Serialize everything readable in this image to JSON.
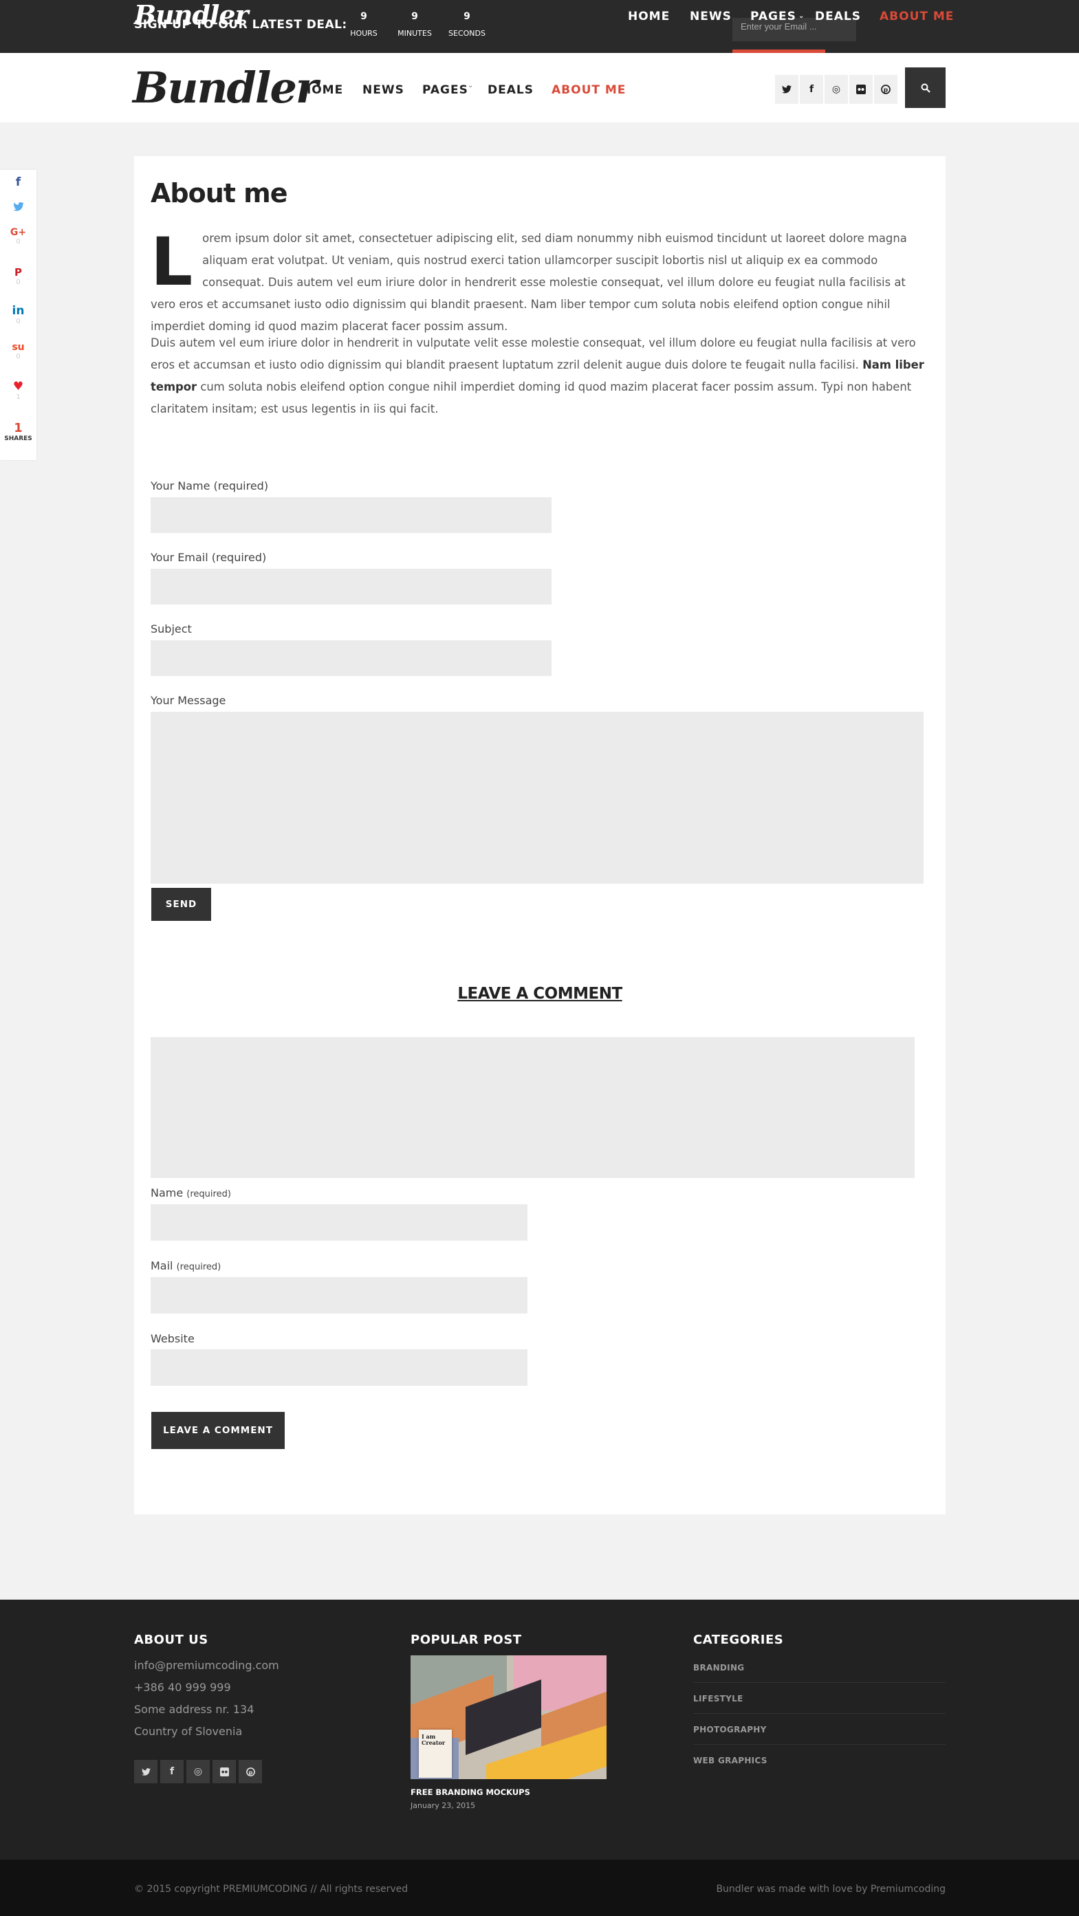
{
  "topbar": {
    "logo": "Bundler",
    "deal_text": "SIGN UP TO OUR LATEST DEAL:",
    "countdown": [
      {
        "value": "9",
        "unit": "HOURS"
      },
      {
        "value": "9",
        "unit": "MINUTES"
      },
      {
        "value": "9",
        "unit": "SECONDS"
      }
    ],
    "email_placeholder": "Enter your Email ...",
    "nav": [
      "HOME",
      "NEWS",
      "PAGES",
      "DEALS",
      "ABOUT ME"
    ]
  },
  "header": {
    "logo": "Bundler",
    "nav": [
      "HOME",
      "NEWS",
      "PAGES",
      "DEALS",
      "ABOUT ME"
    ],
    "social_icons": [
      "twitter-icon",
      "facebook-icon",
      "dribbble-icon",
      "flickr-icon",
      "pinterest-icon"
    ],
    "search_icon": "search-icon"
  },
  "share": {
    "items": [
      {
        "icon": "facebook-icon",
        "glyph": "f",
        "count": "",
        "color": "#3b5998"
      },
      {
        "icon": "twitter-icon",
        "glyph": "🐦",
        "count": "",
        "color": "#55acee"
      },
      {
        "icon": "google-plus-icon",
        "glyph": "G+",
        "count": "0",
        "color": "#dd4b39"
      },
      {
        "icon": "pinterest-icon",
        "glyph": "P",
        "count": "0",
        "color": "#cb2027"
      },
      {
        "icon": "linkedin-icon",
        "glyph": "in",
        "count": "0",
        "color": "#0077b5"
      },
      {
        "icon": "stumbleupon-icon",
        "glyph": "su",
        "count": "0",
        "color": "#eb4924"
      },
      {
        "icon": "heart-icon",
        "glyph": "♥",
        "count": "1",
        "color": "#e8202a"
      }
    ],
    "total": "1",
    "total_label": "SHARES"
  },
  "page": {
    "title": "About me",
    "dropcap": "L",
    "p1": "orem ipsum dolor sit amet, consectetuer adipiscing elit, sed diam nonummy nibh euismod tincidunt ut laoreet dolore magna aliquam erat volutpat. Ut veniam, quis nostrud exerci tation ullamcorper suscipit lobortis nisl ut aliquip ex ea commodo consequat. Duis autem vel eum iriure dolor in hendrerit esse molestie consequat, vel illum dolore eu feugiat nulla facilisis at vero eros et accumsanet iusto odio dignissim qui blandit praesent. Nam liber tempor cum soluta nobis eleifend option congue nihil imperdiet doming id quod mazim placerat facer possim assum.",
    "p2_a": "Duis autem vel eum iriure dolor in hendrerit in vulputate velit esse molestie consequat, vel illum dolore eu feugiat nulla facilisis at vero eros et accumsan et iusto odio dignissim qui blandit praesent luptatum zzril delenit augue duis dolore te feugait nulla facilisi. ",
    "p2_bold": "Nam liber tempor",
    "p2_b": " cum soluta nobis eleifend option congue nihil imperdiet doming id quod mazim placerat facer possim assum. Typi non habent claritatem insitam; est usus legentis in iis qui facit."
  },
  "contact_form": {
    "name_label": "Your Name (required)",
    "email_label": "Your Email (required)",
    "subject_label": "Subject",
    "message_label": "Your Message",
    "send": "SEND"
  },
  "comment_form": {
    "title": "LEAVE A COMMENT",
    "name_label": "Name",
    "mail_label": "Mail",
    "required": "(required)",
    "website_label": "Website",
    "submit": "LEAVE A COMMENT"
  },
  "footer": {
    "about_title": "ABOUT US",
    "about_lines": [
      "info@premiumcoding.com",
      "+386 40 999 999",
      "Some address nr. 134",
      "Country of Slovenia"
    ],
    "social_icons": [
      "twitter-icon",
      "facebook-icon",
      "dribbble-icon",
      "flickr-icon",
      "pinterest-icon"
    ],
    "popular_title": "POPULAR POST",
    "post_title": "FREE BRANDING MOCKUPS",
    "post_date": "January 23, 2015",
    "post_image_text": "I am Creator",
    "categories_title": "CATEGORIES",
    "categories": [
      "BRANDING",
      "LIFESTYLE",
      "PHOTOGRAPHY",
      "WEB GRAPHICS"
    ],
    "copyright": "© 2015 copyright PREMIUMCODING // All rights reserved",
    "made_with": "Bundler was made with love by Premiumcoding"
  },
  "colors": {
    "accent": "#d94a38",
    "dark": "#333333",
    "footer": "#222222"
  }
}
